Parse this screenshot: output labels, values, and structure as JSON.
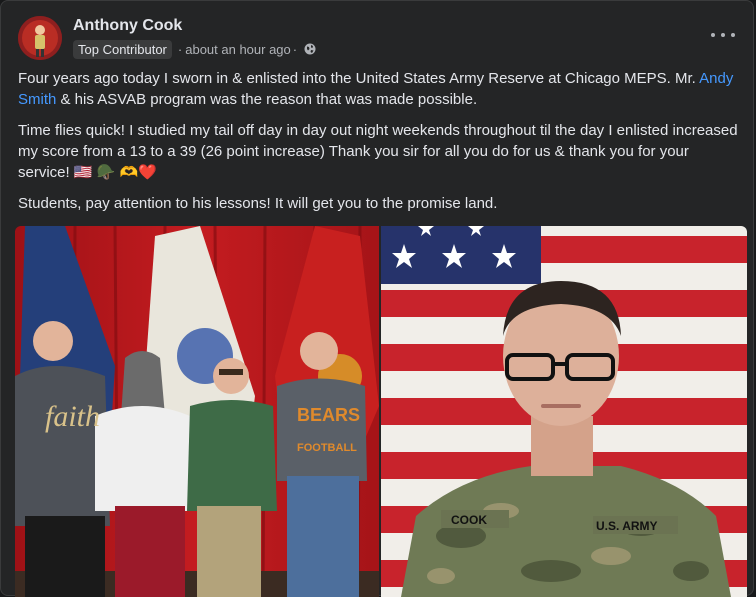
{
  "post": {
    "author": "Anthony Cook",
    "badge": "Top Contributor",
    "separator": "·",
    "timestamp": "about an hour ago",
    "privacy_icon": "public-globe-icon",
    "menu_icon": "more-options-icon"
  },
  "body": {
    "p1_before": "Four years ago today I sworn in & enlisted into the United States Army Reserve at Chicago MEPS. Mr. ",
    "p1_link": "Andy Smith",
    "p1_after": " & his ASVAB program was the reason that was made possible.",
    "p2": "Time flies quick! I studied my tail off day in day out night weekends throughout til the day I enlisted increased my score from a 13 to a 39 (26 point increase) Thank you sir for all you do for us & thank you for your service! 🇺🇸 🪖 🫶❤️",
    "p3": "Students, pay attention to his lessons! It will get you to the promise land."
  },
  "photos": {
    "left": {
      "shirt_text_1": "faith",
      "shirt_text_2": "BEARS",
      "shirt_text_3": "FOOTBALL"
    },
    "right": {
      "name_tape": "COOK",
      "service_tape": "U.S. ARMY"
    }
  },
  "colors": {
    "link": "#4599ff",
    "background": "#242526",
    "curtain": "#b3161b"
  }
}
